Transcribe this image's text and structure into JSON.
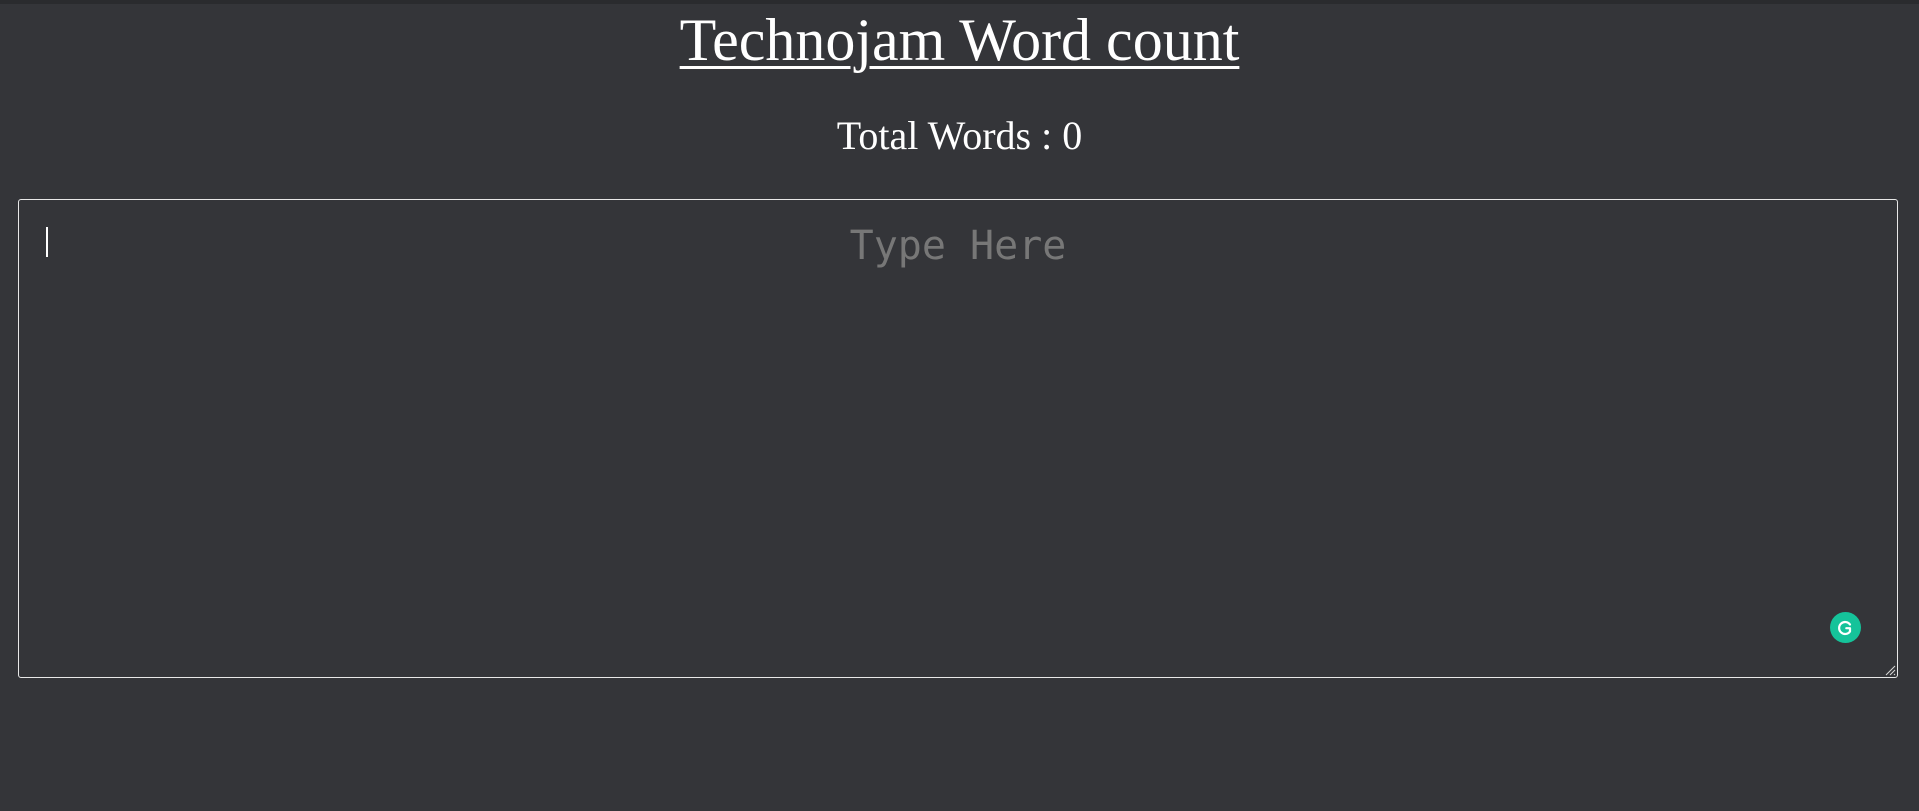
{
  "page": {
    "title": "Technojam Word count"
  },
  "counter": {
    "text": "Total Words : 0",
    "label": "Total Words",
    "value": 0
  },
  "editor": {
    "value": "",
    "placeholder": "Type Here"
  },
  "widgets": {
    "grammarly_icon": "grammarly-icon",
    "grammarly_color": "#15c39a"
  },
  "colors": {
    "background": "#343539",
    "text": "#ffffff",
    "placeholder": "#777777",
    "border": "#e8e8e8"
  }
}
